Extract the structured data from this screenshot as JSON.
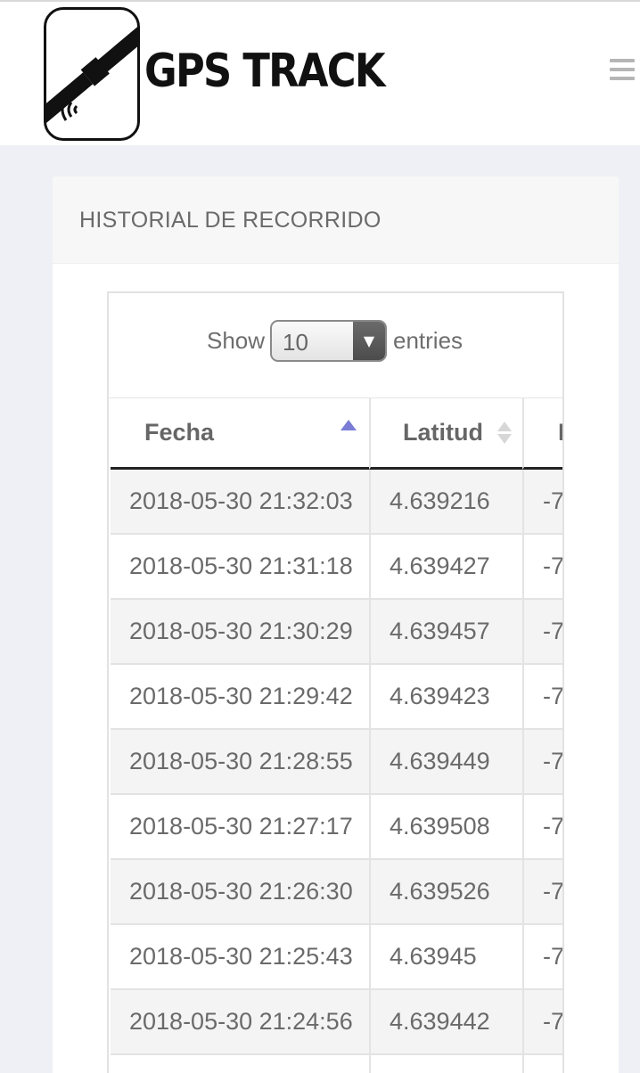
{
  "header": {
    "app_title": "GPS TRACK",
    "logo_icon": "satellite-icon",
    "menu_icon": "hamburger-menu-icon"
  },
  "panel": {
    "title": "HISTORIAL DE RECORRIDO"
  },
  "table_controls": {
    "show_label": "Show",
    "entries_label": "entries",
    "page_length": "10"
  },
  "table": {
    "columns": [
      {
        "label": "Fecha",
        "sort": "ascending"
      },
      {
        "label": "Latitud",
        "sort": "none"
      },
      {
        "label": "L",
        "sort": "none"
      }
    ],
    "rows": [
      {
        "fecha": "2018-05-30 21:32:03",
        "latitud": "4.639216",
        "longitud": "-7"
      },
      {
        "fecha": "2018-05-30 21:31:18",
        "latitud": "4.639427",
        "longitud": "-7"
      },
      {
        "fecha": "2018-05-30 21:30:29",
        "latitud": "4.639457",
        "longitud": "-7"
      },
      {
        "fecha": "2018-05-30 21:29:42",
        "latitud": "4.639423",
        "longitud": "-7"
      },
      {
        "fecha": "2018-05-30 21:28:55",
        "latitud": "4.639449",
        "longitud": "-7"
      },
      {
        "fecha": "2018-05-30 21:27:17",
        "latitud": "4.639508",
        "longitud": "-7"
      },
      {
        "fecha": "2018-05-30 21:26:30",
        "latitud": "4.639526",
        "longitud": "-7"
      },
      {
        "fecha": "2018-05-30 21:25:43",
        "latitud": "4.63945",
        "longitud": "-7"
      },
      {
        "fecha": "2018-05-30 21:24:56",
        "latitud": "4.639442",
        "longitud": "-7"
      },
      {
        "fecha": "",
        "latitud": "",
        "longitud": ""
      }
    ]
  },
  "colors": {
    "page_background": "#eef0f5",
    "sort_active": "#7a7cd6",
    "header_rule": "#222222"
  }
}
